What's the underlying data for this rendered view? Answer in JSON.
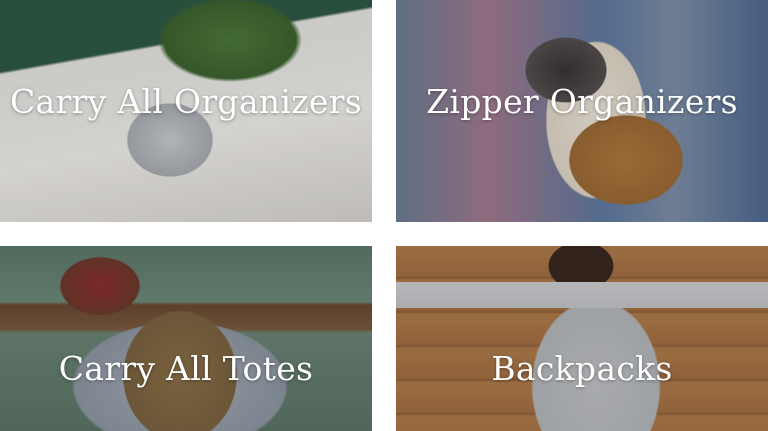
{
  "categories": [
    {
      "label": "Carry All Organizers"
    },
    {
      "label": "Zipper Organizers"
    },
    {
      "label": "Carry All Totes"
    },
    {
      "label": "Backpacks"
    }
  ]
}
